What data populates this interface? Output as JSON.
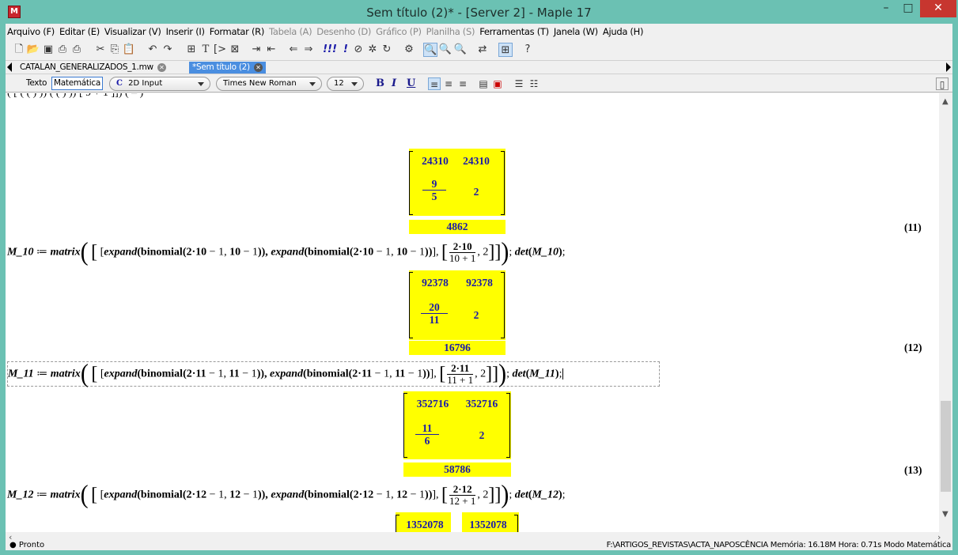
{
  "window": {
    "title": "Sem título (2)* - [Server 2] - Maple 17",
    "app_icon": "maple-leaf-icon",
    "minimize": "–",
    "maximize": "□",
    "close": "✕"
  },
  "menu": [
    {
      "label": "Arquivo (F)",
      "enabled": true
    },
    {
      "label": "Editar (E)",
      "enabled": true
    },
    {
      "label": "Visualizar (V)",
      "enabled": true
    },
    {
      "label": "Inserir (I)",
      "enabled": true
    },
    {
      "label": "Formatar (R)",
      "enabled": true
    },
    {
      "label": "Tabela (A)",
      "enabled": false
    },
    {
      "label": "Desenho (D)",
      "enabled": false
    },
    {
      "label": "Gráfico (P)",
      "enabled": false
    },
    {
      "label": "Planilha (S)",
      "enabled": false
    },
    {
      "label": "Ferramentas (T)",
      "enabled": true
    },
    {
      "label": "Janela (W)",
      "enabled": true
    },
    {
      "label": "Ajuda (H)",
      "enabled": true
    }
  ],
  "toolbar_icons": [
    "new-document-icon",
    "open-icon",
    "save-icon",
    "print-icon",
    "print-preview-icon",
    "cut-icon",
    "copy-icon",
    "paste-icon",
    "undo-icon",
    "redo-icon",
    "insert-math-icon",
    "insert-text-icon",
    "insert-prompt-icon",
    "section-icon",
    "indent-icon",
    "outdent-icon",
    "back-icon",
    "forward-icon",
    "execute-all-icon",
    "execute-icon",
    "stop-icon",
    "debug-icon",
    "restart-icon",
    "gear-icon",
    "zoom-100-icon",
    "zoom-150-icon",
    "zoom-200-icon",
    "toggle-icon",
    "palette-icon",
    "help-icon"
  ],
  "tabs": [
    {
      "label": "CATALAN_GENERALIZADOS_1.mw",
      "active": false
    },
    {
      "label": "*Sem título (2)",
      "active": true
    }
  ],
  "context": {
    "text_mode": "Texto",
    "math_mode": "Matemática",
    "input_mode": "2D Input",
    "input_mode_glyph": "C",
    "font": "Times New Roman",
    "size": "12",
    "bold": "B",
    "italic": "I",
    "underline": "U"
  },
  "document": {
    "partial_top": "(   [    (           (          )   ))    (           (          )   ))  [  9 + 1    ]])  (  –  )",
    "blocks": [
      {
        "label": "",
        "matrix": {
          "a11": "24310",
          "a12": "24310",
          "num": "9",
          "den": "5",
          "a22": "2"
        },
        "det": "4862",
        "eqno": "(11)"
      },
      {
        "input_name": "M_10",
        "n": "10",
        "frac_num": "2·10",
        "frac_den": "10 + 1",
        "matrix": {
          "a11": "92378",
          "a12": "92378",
          "num": "20",
          "den": "11",
          "a22": "2"
        },
        "det": "16796",
        "eqno": "(12)"
      },
      {
        "input_name": "M_11",
        "n": "11",
        "frac_num": "2·11",
        "frac_den": "11 + 1",
        "matrix": {
          "a11": "352716",
          "a12": "352716",
          "num": "11",
          "den": "6",
          "a22": "2"
        },
        "det": "58786",
        "eqno": "(13)"
      },
      {
        "input_name": "M_12",
        "n": "12",
        "frac_num": "2·12",
        "frac_den": "12 + 1",
        "matrix": {
          "a11": "1352078",
          "a12": "1352078"
        }
      }
    ],
    "tokens": {
      "assign": " ≔ ",
      "matrix_fn": "matrix",
      "expand_fn": "expand",
      "binomial_fn": "binomial",
      "det_fn": "det",
      "two_dot": "2·",
      "minus_one": " − 1, ",
      "minus_one_end": " − 1",
      "comma": ", ",
      "two": "2",
      "semicolon": ";"
    }
  },
  "status": {
    "left": "● Pronto",
    "right": "F:\\ARTIGOS_REVISTAS\\ACTA_NAPOSCÊNCIA  Memória: 16.18M  Hora: 0.71s  Modo Matemática"
  }
}
